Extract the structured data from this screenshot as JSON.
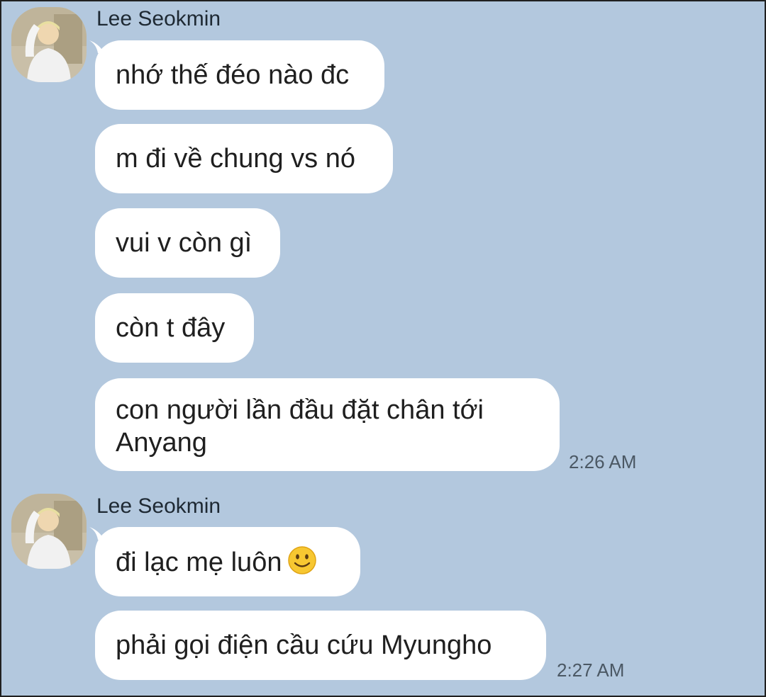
{
  "messages": [
    {
      "sender": "Lee Seokmin",
      "bubbles": [
        "nhớ thế đéo nào đc",
        "m đi về chung vs nó",
        "vui v còn gì",
        "còn t đây",
        "con người lần đầu đặt chân tới Anyang"
      ],
      "last_bubble_lines": [
        "con người lần đầu đặt chân tới",
        "Anyang"
      ],
      "time": "2:26 AM"
    },
    {
      "sender": "Lee Seokmin",
      "bubbles": [
        "đi lạc mẹ luôn",
        "phải gọi điện cầu cứu Myungho"
      ],
      "time": "2:27 AM"
    }
  ],
  "colors": {
    "background": "#b3c8de",
    "bubble": "#ffffff",
    "text": "#1f1f1f",
    "timestamp": "#4b5864"
  },
  "icons": {
    "avatar": "profile-photo",
    "emoji": "slightly-smiling-face-icon"
  }
}
